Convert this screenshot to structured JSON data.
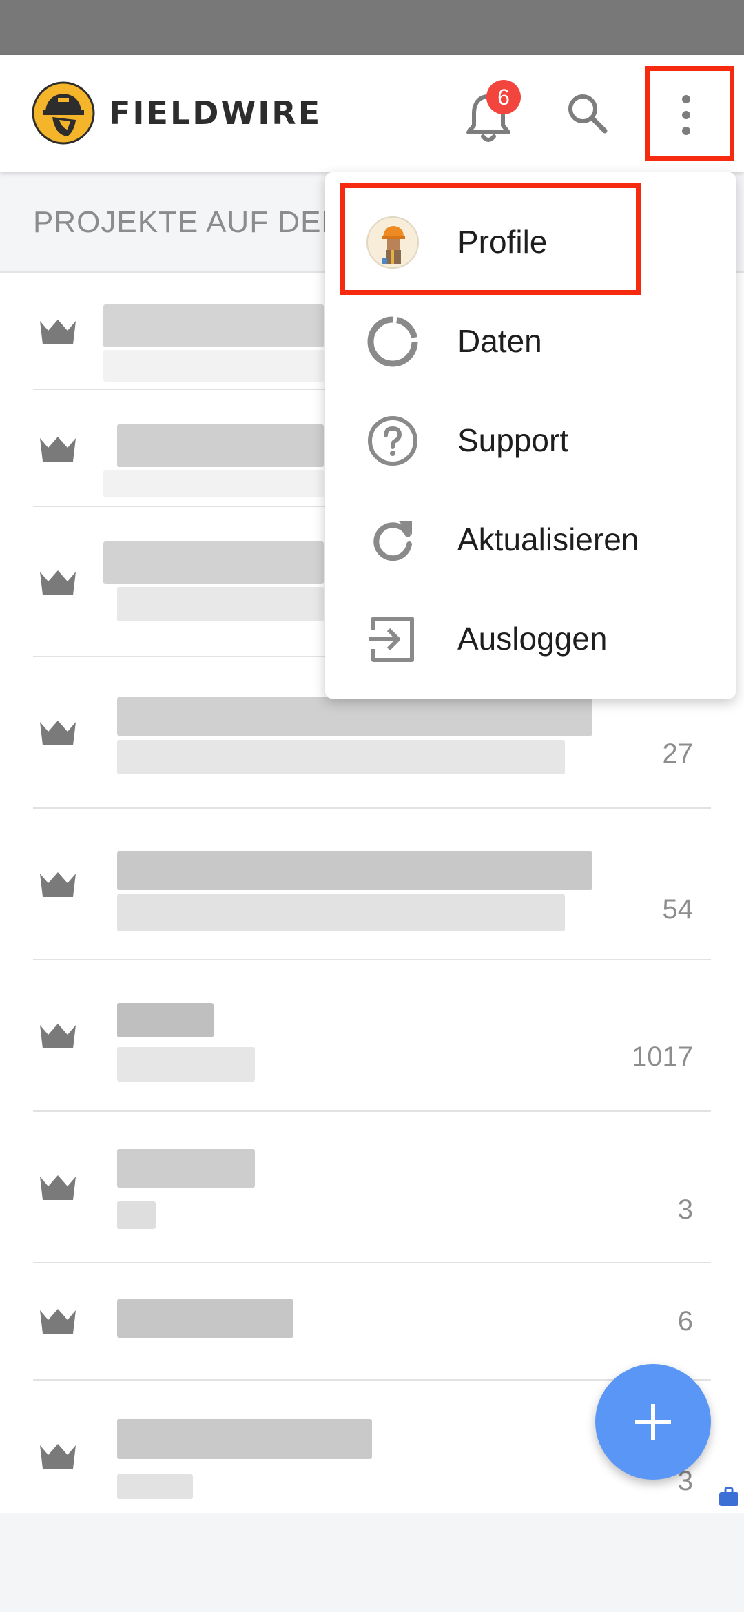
{
  "app_bar": {
    "brand": "FIELDWIRE",
    "notification_count": "6",
    "icons": [
      "fieldwire-logo-icon",
      "bell-icon",
      "search-icon",
      "more-vert-icon"
    ]
  },
  "section": {
    "title": "PROJEKTE AUF DEM"
  },
  "menu": {
    "items": [
      {
        "label": "Profile",
        "icon": "avatar-icon"
      },
      {
        "label": "Daten",
        "icon": "ring-chart-icon"
      },
      {
        "label": "Support",
        "icon": "help-circle-icon"
      },
      {
        "label": "Aktualisieren",
        "icon": "refresh-icon"
      },
      {
        "label": "Ausloggen",
        "icon": "logout-icon"
      }
    ]
  },
  "projects": [
    {
      "count": ""
    },
    {
      "count": ""
    },
    {
      "count": ""
    },
    {
      "count": "27"
    },
    {
      "count": "54"
    },
    {
      "count": "1017"
    },
    {
      "count": "3"
    },
    {
      "count": "6"
    },
    {
      "count": "3"
    }
  ],
  "colors": {
    "accent_blue": "#5a96f5",
    "badge_red": "#f2453d",
    "highlight_red": "#f52a0f",
    "logo_yellow": "#f5b52a"
  }
}
